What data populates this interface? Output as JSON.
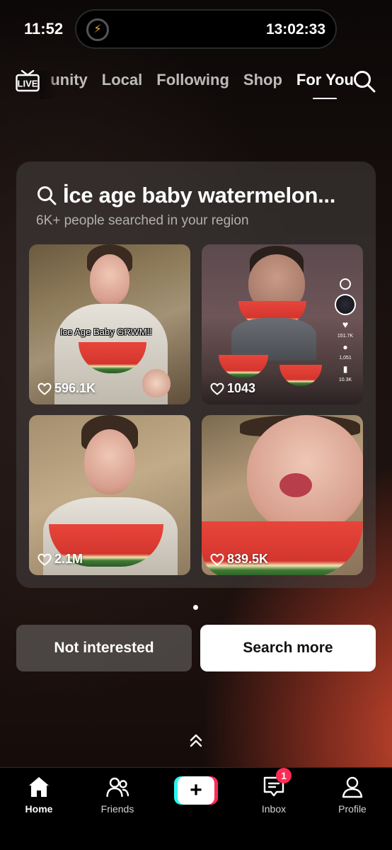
{
  "status_bar": {
    "time": "11:52",
    "timer": "13:02:33"
  },
  "top_nav": {
    "tabs": [
      {
        "label": "unity",
        "active": false
      },
      {
        "label": "Local",
        "active": false
      },
      {
        "label": "Following",
        "active": false
      },
      {
        "label": "Shop",
        "active": false
      },
      {
        "label": "For You",
        "active": true
      }
    ],
    "live_icon_text": "LIVE"
  },
  "search_card": {
    "title": "İce age baby watermelon...",
    "subtitle": "6K+ people searched in your region",
    "results": [
      {
        "likes": "596.1K",
        "overlay_text": "Ice Age Baby GRWM!!"
      },
      {
        "likes": "1043",
        "side_counts": [
          "151.7K",
          "1,051",
          "10.3K"
        ]
      },
      {
        "likes": "2.1M"
      },
      {
        "likes": "839.5K"
      }
    ]
  },
  "actions": {
    "not_interested": "Not interested",
    "search_more": "Search more"
  },
  "bottom_nav": {
    "home": "Home",
    "friends": "Friends",
    "inbox": "Inbox",
    "inbox_badge": "1",
    "profile": "Profile",
    "create": "+"
  },
  "colors": {
    "accent_cyan": "#25f4ee",
    "accent_red": "#fe2c55",
    "card_bg": "#46423f"
  }
}
